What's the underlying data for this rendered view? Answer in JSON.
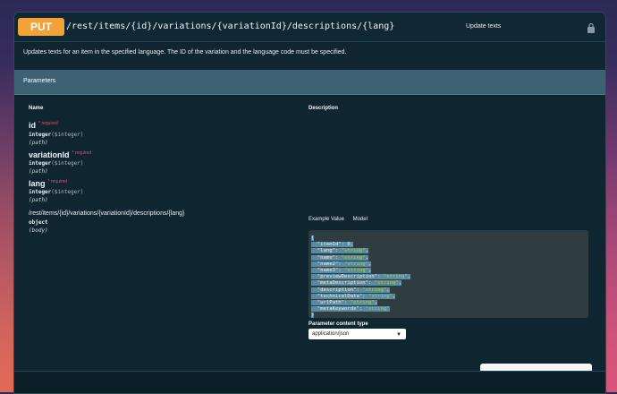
{
  "operation": {
    "method": "PUT",
    "path": "/rest/items/{id}/variations/{variationId}/descriptions/{lang}",
    "summary": "Update texts",
    "description": "Updates texts for an item in the specified language. The ID of the variation and the language code must be specified."
  },
  "parameters": {
    "title": "Parameters",
    "col_name": "Name",
    "col_description": "Description",
    "required_label": "* required",
    "items": [
      {
        "name": "id",
        "type": "integer",
        "format": "($integer)",
        "in": "(path)"
      },
      {
        "name": "variationId",
        "type": "integer",
        "format": "($integer)",
        "in": "(path)"
      },
      {
        "name": "lang",
        "type": "integer",
        "format": "($integer)",
        "in": "(path)"
      }
    ],
    "body": {
      "name": "/rest/items/{id}/variations/{variationId}/descriptions/{lang}",
      "type": "object",
      "in": "(body)"
    }
  },
  "example": {
    "tabs": [
      "Example Value",
      "Model"
    ],
    "keys": [
      "itemId",
      "lang",
      "name",
      "name2",
      "name3",
      "previewDescription",
      "metaDescription",
      "description",
      "technicalData",
      "urlPath",
      "metaKeywords"
    ],
    "string_value": "\"string\""
  },
  "content_type": {
    "label": "Parameter content type",
    "selected": "application/json"
  },
  "colors": {
    "method_put": "#f3a23a",
    "panel_bg": "#0f2530",
    "params_bar": "#3f6174",
    "required": "#d4546b"
  }
}
